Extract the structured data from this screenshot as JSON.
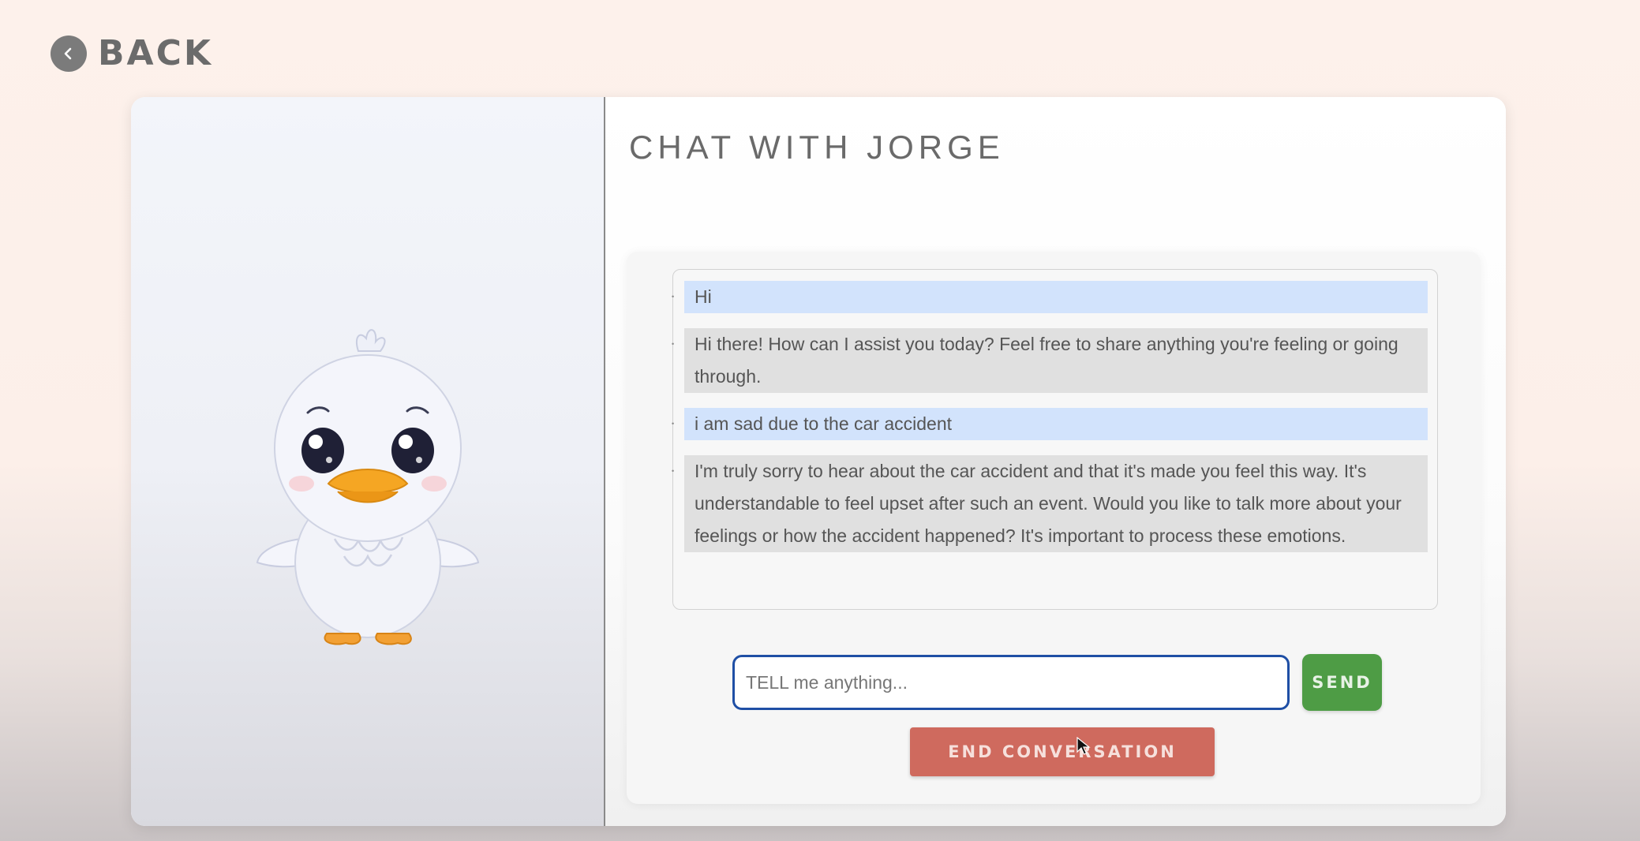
{
  "header": {
    "back_label": "BACK",
    "back_icon": "chevron-left-icon"
  },
  "character": {
    "image": "duck-mascot"
  },
  "chat": {
    "title": "CHAT WITH JORGE",
    "messages": [
      {
        "role": "user",
        "text": "Hi"
      },
      {
        "role": "bot",
        "text": "Hi there! How can I assist you today? Feel free to share anything you're feeling or going through."
      },
      {
        "role": "user",
        "text": "i am sad due to the car accident"
      },
      {
        "role": "bot",
        "text": "I'm truly sorry to hear about the car accident and that it's made you feel this way. It's understandable to feel upset after such an event. Would you like to talk more about your feelings or how the accident happened? It's important to process these emotions."
      }
    ],
    "input": {
      "value": "",
      "placeholder": "TELL me anything..."
    },
    "send_label": "SEND",
    "end_label": "END CONVERSATION"
  },
  "colors": {
    "user_bubble": "#d2e3fc",
    "bot_bubble": "#e0e0e0",
    "send_button": "#4e9c45",
    "end_button": "#cf6a5e",
    "input_border": "#1f4fa5"
  }
}
